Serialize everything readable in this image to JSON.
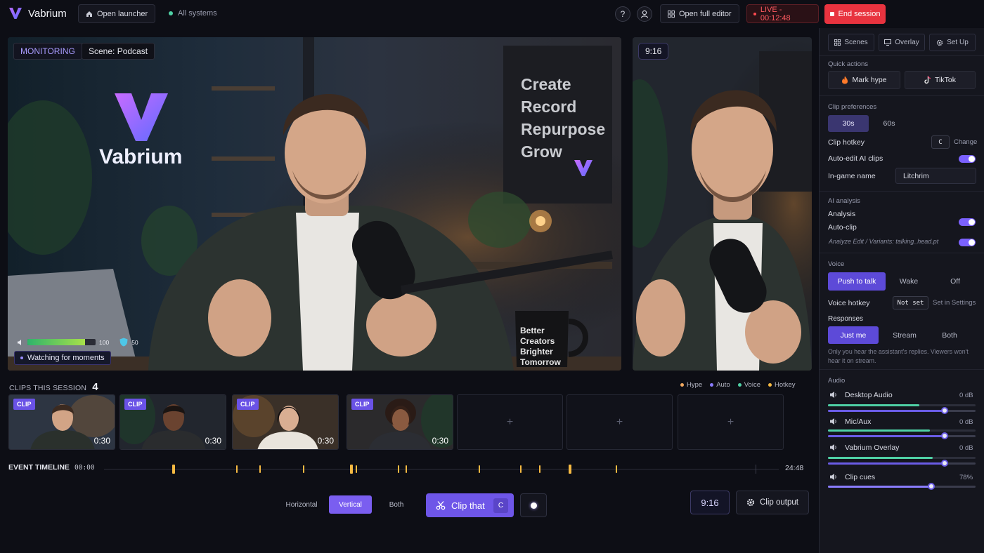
{
  "app": {
    "name": "Vabrium"
  },
  "topbar": {
    "open_launcher": "Open launcher",
    "systems_status": "All systems",
    "help_label": "?",
    "open_full_editor": "Open full editor",
    "live_label": "LIVE - 00:12:48",
    "end_session": "End session"
  },
  "preview": {
    "monitoring_label": "MONITORING",
    "scene_label": "Scene: Podcast",
    "vertical_ratio": "9:16",
    "audio_level": 100,
    "audio_level_fraction": 0.85,
    "shield_level": 50,
    "status_text": "Watching for moments"
  },
  "background_text": {
    "brand": "Vabrium",
    "poster_lines": [
      "Create",
      "Record",
      "Repurpose",
      "Grow"
    ],
    "mug_lines": [
      "Better",
      "Creators",
      "Brighter",
      "Tomorrow"
    ]
  },
  "clips": {
    "header": "CLIPS THIS SESSION",
    "count": "4",
    "legend": [
      {
        "label": "Hype",
        "color": "#f0a860"
      },
      {
        "label": "Auto",
        "color": "#8a7cff"
      },
      {
        "label": "Voice",
        "color": "#4fd1a5"
      },
      {
        "label": "Hotkey",
        "color": "#f5b942"
      }
    ],
    "items": [
      {
        "badge": "CLIP",
        "duration": "0:30"
      },
      {
        "badge": "CLIP",
        "duration": "0:30"
      },
      {
        "badge": "CLIP",
        "duration": "0:30"
      },
      {
        "badge": "CLIP",
        "duration": "0:30"
      }
    ],
    "empty_slot_icon": "+"
  },
  "timeline": {
    "label": "EVENT TIMELINE",
    "start": "00:00",
    "end": "24:48",
    "marker_color": "#f5b942"
  },
  "bottom": {
    "orientation": [
      "Horizontal",
      "Vertical",
      "Both"
    ],
    "orientation_selected": "Vertical",
    "clip_that": "Clip that",
    "clip_key": "C",
    "ratio": "9:16",
    "clip_output": "Clip output"
  },
  "sidebar": {
    "tabs": [
      "Scenes",
      "Overlay",
      "Set Up"
    ],
    "quick_actions": {
      "title": "Quick actions",
      "mark_hype": "Mark hype",
      "tiktok": "TikTok"
    },
    "clip_prefs": {
      "title": "Clip preferences",
      "lengths": [
        "30s",
        "60s"
      ],
      "selected": "30s",
      "hotkey_label": "Clip hotkey",
      "hotkey_key": "C",
      "hotkey_change": "Change",
      "auto_edit_label": "Auto-edit AI clips",
      "auto_edit_on": true,
      "ingame_label": "In-game name",
      "ingame_value": "Litchrim"
    },
    "ai": {
      "title": "AI analysis",
      "analysis_label": "Analysis",
      "analysis_on": true,
      "autoclip_label": "Auto-clip",
      "autoclip_on": true,
      "note": "Analyze Edit / Variants: talking_head.pt"
    },
    "voice": {
      "title": "Voice",
      "modes": [
        "Push to talk",
        "Wake",
        "Off"
      ],
      "selected": "Push to talk",
      "hotkey_label": "Voice hotkey",
      "hotkey_value": "Not set",
      "hotkey_link": "Set in Settings",
      "responses_label": "Responses",
      "responses": [
        "Just me",
        "Stream",
        "Both"
      ],
      "responses_selected": "Just me",
      "note": "Only you hear the assistant's replies. Viewers won't hear it on stream."
    },
    "audio": {
      "title": "Audio",
      "channels": [
        {
          "name": "Desktop Audio",
          "value": "0 dB",
          "level": 0.62,
          "knob": 0.79
        },
        {
          "name": "Mic/Aux",
          "value": "0 dB",
          "level": 0.69,
          "knob": 0.79
        },
        {
          "name": "Vabrium Overlay",
          "value": "0 dB",
          "level": 0.71,
          "knob": 0.79
        },
        {
          "name": "Clip cues",
          "value": "78%",
          "level": 0.7,
          "knob": 0.7
        }
      ]
    }
  },
  "colors": {
    "accent": "#7b61ff",
    "live": "#ff5a5f",
    "end_session": "#e8333f",
    "level": "#4fd1a5"
  }
}
